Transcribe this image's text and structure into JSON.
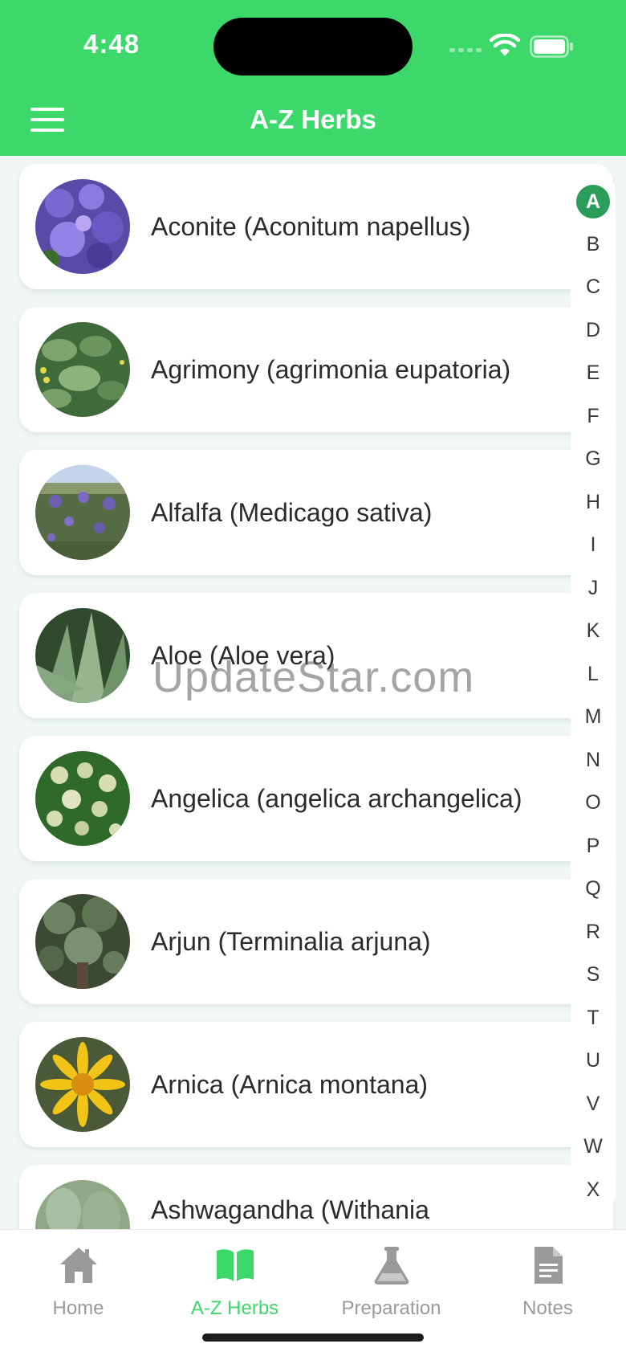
{
  "status_bar": {
    "time": "4:48"
  },
  "header": {
    "title": "A-Z Herbs",
    "menu_icon": "hamburger-menu-icon"
  },
  "colors": {
    "accent": "#3dd86a",
    "active_index": "#2a9d5a",
    "tab_inactive": "#9a9a9a"
  },
  "herbs": [
    {
      "name": "Aconite (Aconitum napellus)",
      "image": "aconite-photo"
    },
    {
      "name": "Agrimony (agrimonia eupatoria)",
      "image": "agrimony-photo"
    },
    {
      "name": "Alfalfa (Medicago sativa)",
      "image": "alfalfa-photo"
    },
    {
      "name": "Aloe (Aloe vera)",
      "image": "aloe-photo"
    },
    {
      "name": "Angelica (angelica archangelica)",
      "image": "angelica-photo"
    },
    {
      "name": "Arjun (Terminalia arjuna)",
      "image": "arjun-photo"
    },
    {
      "name": "Arnica (Arnica montana)",
      "image": "arnica-photo"
    },
    {
      "name": "Ashwagandha (Withania",
      "image": "ashwagandha-photo"
    }
  ],
  "alphabet": {
    "active": "A",
    "letters": [
      "A",
      "B",
      "C",
      "D",
      "E",
      "F",
      "G",
      "H",
      "I",
      "J",
      "K",
      "L",
      "M",
      "N",
      "O",
      "P",
      "Q",
      "R",
      "S",
      "T",
      "U",
      "V",
      "W",
      "X"
    ]
  },
  "watermark": "UpdateStar.com",
  "tabs": [
    {
      "label": "Home",
      "icon": "home-icon",
      "active": false
    },
    {
      "label": "A-Z Herbs",
      "icon": "open-book-icon",
      "active": true
    },
    {
      "label": "Preparation",
      "icon": "flask-icon",
      "active": false
    },
    {
      "label": "Notes",
      "icon": "document-icon",
      "active": false
    }
  ]
}
